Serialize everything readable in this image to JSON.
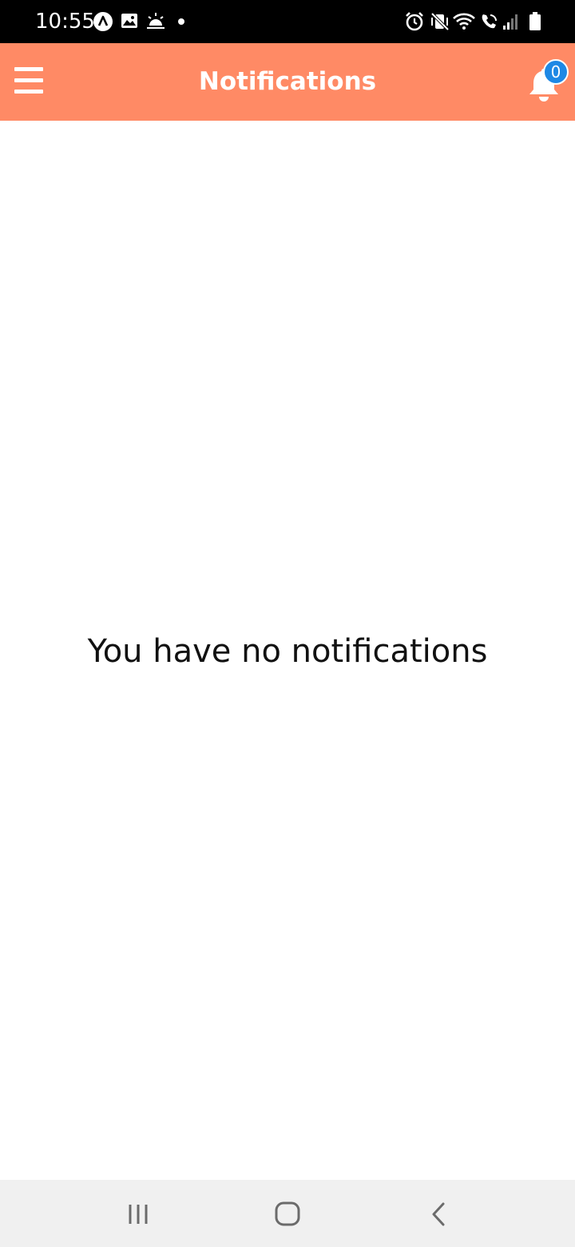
{
  "status_bar": {
    "time": "10:55",
    "left_icons": [
      "app-a-icon",
      "gallery-icon",
      "weather-sunrise-icon",
      "dot-icon"
    ],
    "right_icons": [
      "alarm-icon",
      "vibrate-mute-icon",
      "wifi-icon",
      "wifi-calling-icon",
      "signal-icon",
      "battery-icon"
    ]
  },
  "app_bar": {
    "title": "Notifications",
    "menu_icon": "hamburger-menu-icon",
    "bell_icon": "bell-icon",
    "badge_count": "0",
    "background_color": "#FF8A65",
    "badge_color": "#1E88E5"
  },
  "content": {
    "empty_message": "You have no notifications"
  },
  "nav_bar": {
    "buttons": [
      "recent-apps-icon",
      "home-icon",
      "back-icon"
    ]
  }
}
